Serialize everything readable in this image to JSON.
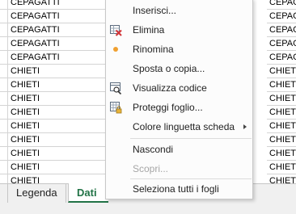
{
  "grid": {
    "rows": [
      {
        "col_a": "",
        "col_b": "CEPAGATTI",
        "col_c": "CEPAG"
      },
      {
        "col_a": "",
        "col_b": "CEPAGATTI",
        "col_c": "CEPAG"
      },
      {
        "col_a": "",
        "col_b": "CEPAGATTI",
        "col_c": "CEPAG"
      },
      {
        "col_a": "",
        "col_b": "CEPAGATTI",
        "col_c": "CEPAG"
      },
      {
        "col_a": "",
        "col_b": "CEPAGATTI",
        "col_c": "CEPAG"
      },
      {
        "col_a": "",
        "col_b": "CHIETI",
        "col_c": "CHIET"
      },
      {
        "col_a": "",
        "col_b": "CHIETI",
        "col_c": "CHIET"
      },
      {
        "col_a": "",
        "col_b": "CHIETI",
        "col_c": "CHIET"
      },
      {
        "col_a": "",
        "col_b": "CHIETI",
        "col_c": "CHIET"
      },
      {
        "col_a": "",
        "col_b": "CHIETI",
        "col_c": "CHIET"
      },
      {
        "col_a": "",
        "col_b": "CHIETI",
        "col_c": "CHIET"
      },
      {
        "col_a": "",
        "col_b": "CHIETI",
        "col_c": "CHIET"
      },
      {
        "col_a": "",
        "col_b": "CHIETI",
        "col_c": "CHIET"
      },
      {
        "col_a": "",
        "col_b": "CHIETI",
        "col_c": "CHIET"
      }
    ]
  },
  "context_menu": {
    "items": [
      {
        "label": "Inserisci...",
        "icon": "none",
        "disabled": false,
        "submenu": false
      },
      {
        "label": "Elimina",
        "icon": "delete-sheet-icon",
        "disabled": false,
        "submenu": false
      },
      {
        "label": "Rinomina",
        "icon": "bullet-icon",
        "disabled": false,
        "submenu": false
      },
      {
        "label": "Sposta o copia...",
        "icon": "none",
        "disabled": false,
        "submenu": false
      },
      {
        "label": "Visualizza codice",
        "icon": "view-code-icon",
        "disabled": false,
        "submenu": false
      },
      {
        "label": "Proteggi foglio...",
        "icon": "protect-sheet-icon",
        "disabled": false,
        "submenu": false
      },
      {
        "label": "Colore linguetta scheda",
        "icon": "none",
        "disabled": false,
        "submenu": true
      },
      {
        "label": "Nascondi",
        "icon": "none",
        "disabled": false,
        "submenu": false
      },
      {
        "label": "Scopri...",
        "icon": "none",
        "disabled": true,
        "submenu": false
      },
      {
        "label": "Seleziona tutti i fogli",
        "icon": "none",
        "disabled": false,
        "submenu": false
      }
    ]
  },
  "sheet_tabs": [
    {
      "label": "Legenda",
      "active": false
    },
    {
      "label": "Dati",
      "active": true
    }
  ],
  "colors": {
    "accent": "#217346",
    "bullet": "#f0a030",
    "delete_x": "#d13438"
  }
}
